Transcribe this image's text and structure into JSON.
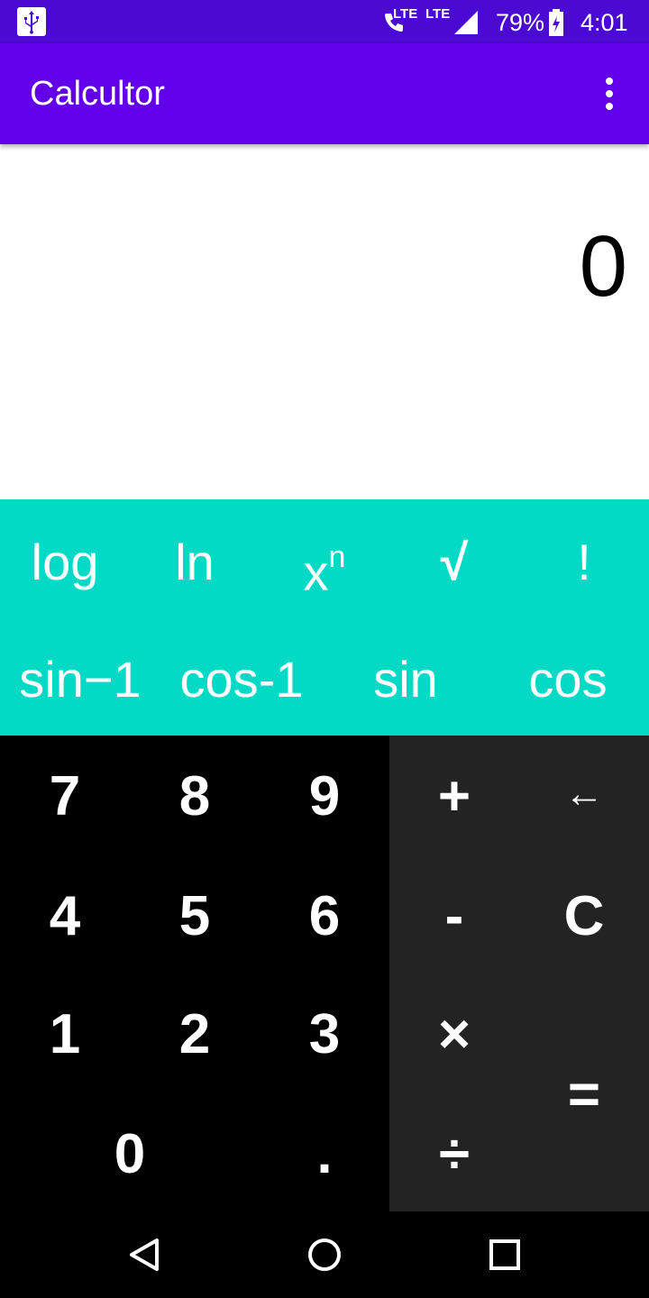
{
  "status_bar": {
    "lte1": "LTE",
    "lte2": "LTE",
    "battery": "79%",
    "time": "4:01"
  },
  "app_bar": {
    "title": "Calcultor"
  },
  "display": {
    "value": "0"
  },
  "scientific": {
    "row1": [
      "log",
      "ln",
      "x",
      "√",
      "!"
    ],
    "xn_sup": "n",
    "row2": [
      "sin−1",
      "cos-1",
      "sin",
      "cos"
    ]
  },
  "keypad": {
    "digits": [
      "7",
      "8",
      "9",
      "4",
      "5",
      "6",
      "1",
      "2",
      "3",
      "0",
      "."
    ],
    "ops": {
      "plus": "+",
      "backspace": "←",
      "minus": "-",
      "clear": "C",
      "multiply": "×",
      "equals": "=",
      "divide": "÷"
    }
  },
  "colors": {
    "status_bar": "#4b0ad1",
    "app_bar": "#6200ea",
    "scientific_panel": "#03dac6",
    "numpad": "#000000",
    "op_pad": "#232323"
  }
}
